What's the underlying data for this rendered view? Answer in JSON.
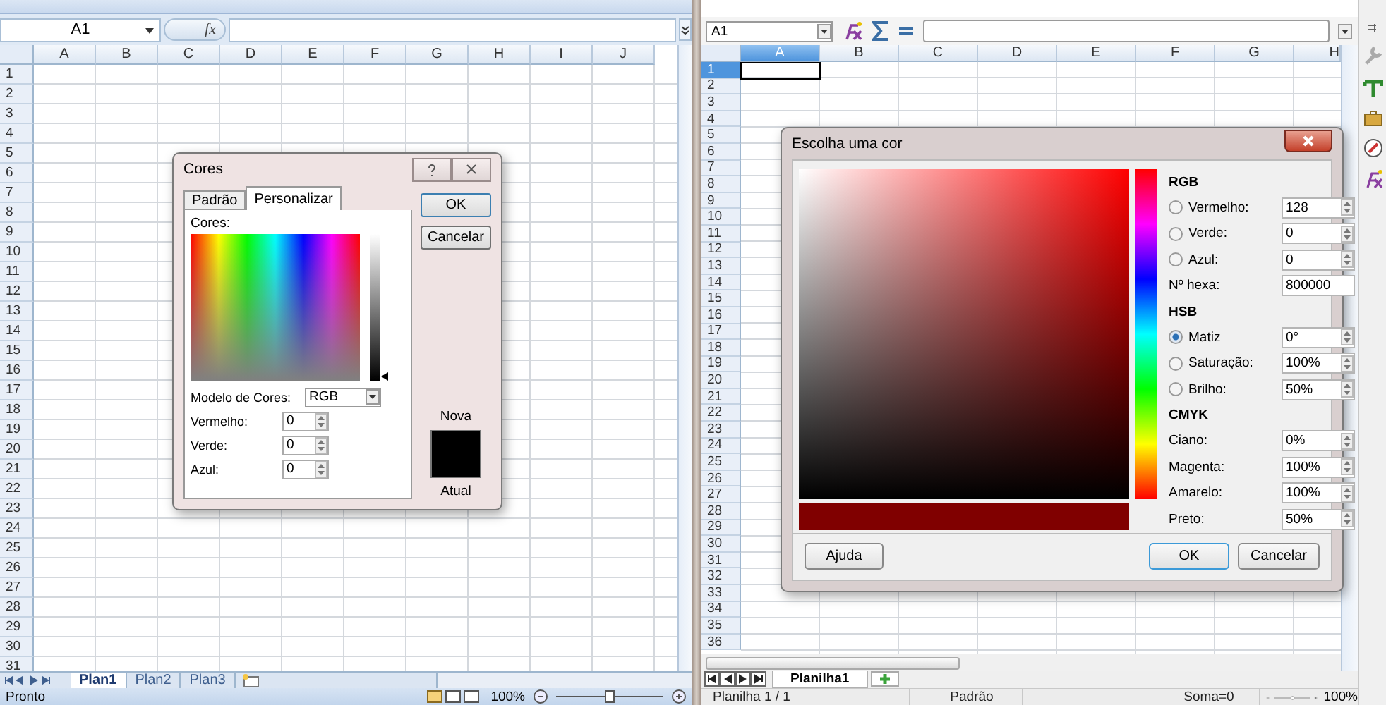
{
  "excel": {
    "name_box": "A1",
    "fx": "fx",
    "columns": [
      "A",
      "B",
      "C",
      "D",
      "E",
      "F",
      "G",
      "H",
      "I",
      "J"
    ],
    "rows": [
      "1",
      "2",
      "3",
      "4",
      "5",
      "6",
      "7",
      "8",
      "9",
      "10",
      "11",
      "12",
      "13",
      "14",
      "15",
      "16",
      "17",
      "18",
      "19",
      "20",
      "21",
      "22",
      "23",
      "24",
      "25",
      "26",
      "27",
      "28",
      "29",
      "30",
      "31"
    ],
    "sheet_tabs": [
      {
        "label": "Plan1",
        "selected": true
      },
      {
        "label": "Plan2",
        "selected": false
      },
      {
        "label": "Plan3",
        "selected": false
      }
    ],
    "status": "Pronto",
    "zoom": "100%",
    "zoom_slider": {
      "level": 0.5
    }
  },
  "cores_dialog": {
    "title": "Cores",
    "tabs": [
      {
        "label": "Padrão",
        "selected": false
      },
      {
        "label": "Personalizar",
        "selected": true
      }
    ],
    "colors_label": "Cores:",
    "model_label": "Modelo de Cores:",
    "model_value": "RGB",
    "fields": [
      {
        "label": "Vermelho:",
        "value": "0"
      },
      {
        "label": "Verde:",
        "value": "0"
      },
      {
        "label": "Azul:",
        "value": "0"
      }
    ],
    "new_label": "Nova",
    "current_label": "Atual",
    "buttons": [
      "OK",
      "Cancelar"
    ]
  },
  "calc": {
    "name_box": "A1",
    "columns": [
      {
        "label": "A",
        "selected": true
      },
      {
        "label": "B",
        "selected": false
      },
      {
        "label": "C",
        "selected": false
      },
      {
        "label": "D",
        "selected": false
      },
      {
        "label": "E",
        "selected": false
      },
      {
        "label": "F",
        "selected": false
      },
      {
        "label": "G",
        "selected": false
      },
      {
        "label": "H",
        "selected": false
      }
    ],
    "rows": [
      {
        "label": "1",
        "selected": true
      },
      {
        "label": "2",
        "selected": false
      },
      {
        "label": "3",
        "selected": false
      },
      {
        "label": "4",
        "selected": false
      },
      {
        "label": "5",
        "selected": false
      },
      {
        "label": "6",
        "selected": false
      },
      {
        "label": "7",
        "selected": false
      },
      {
        "label": "8",
        "selected": false
      },
      {
        "label": "9",
        "selected": false
      },
      {
        "label": "10",
        "selected": false
      },
      {
        "label": "11",
        "selected": false
      },
      {
        "label": "12",
        "selected": false
      },
      {
        "label": "13",
        "selected": false
      },
      {
        "label": "14",
        "selected": false
      },
      {
        "label": "15",
        "selected": false
      },
      {
        "label": "16",
        "selected": false
      },
      {
        "label": "17",
        "selected": false
      },
      {
        "label": "18",
        "selected": false
      },
      {
        "label": "19",
        "selected": false
      },
      {
        "label": "20",
        "selected": false
      },
      {
        "label": "21",
        "selected": false
      },
      {
        "label": "22",
        "selected": false
      },
      {
        "label": "23",
        "selected": false
      },
      {
        "label": "24",
        "selected": false
      },
      {
        "label": "25",
        "selected": false
      },
      {
        "label": "26",
        "selected": false
      },
      {
        "label": "27",
        "selected": false
      },
      {
        "label": "28",
        "selected": false
      },
      {
        "label": "29",
        "selected": false
      },
      {
        "label": "30",
        "selected": false
      },
      {
        "label": "31",
        "selected": false
      },
      {
        "label": "32",
        "selected": false
      },
      {
        "label": "33",
        "selected": false
      },
      {
        "label": "34",
        "selected": false
      },
      {
        "label": "35",
        "selected": false
      },
      {
        "label": "36",
        "selected": false
      }
    ],
    "sheet_tabs": [
      {
        "label": "Planilha1",
        "selected": true
      }
    ],
    "status": [
      "Planilha 1 / 1",
      "Padrão",
      "Soma=0"
    ],
    "zoom": "100%",
    "zoom_slider": {
      "level": 0.5
    }
  },
  "color_dialog": {
    "title": "Escolha uma cor",
    "sections": [
      {
        "title": "RGB",
        "rows": [
          {
            "kind": "radio",
            "label": "Vermelho:",
            "value": "128",
            "selected": false
          },
          {
            "kind": "radio",
            "label": "Verde:",
            "value": "0",
            "selected": false
          },
          {
            "kind": "radio",
            "label": "Azul:",
            "value": "0",
            "selected": false
          },
          {
            "kind": "text",
            "label": "Nº hexa:",
            "value": "800000"
          }
        ]
      },
      {
        "title": "HSB",
        "rows": [
          {
            "kind": "radio",
            "label": "Matiz",
            "value": "0°",
            "selected": true
          },
          {
            "kind": "radio",
            "label": "Saturação:",
            "value": "100%",
            "selected": false
          },
          {
            "kind": "radio",
            "label": "Brilho:",
            "value": "50%",
            "selected": false
          }
        ]
      },
      {
        "title": "CMYK",
        "rows": [
          {
            "kind": "spin",
            "label": "Ciano:",
            "value": "0%"
          },
          {
            "kind": "spin",
            "label": "Magenta:",
            "value": "100%"
          },
          {
            "kind": "spin",
            "label": "Amarelo:",
            "value": "100%"
          },
          {
            "kind": "spin",
            "label": "Preto:",
            "value": "50%"
          }
        ]
      }
    ],
    "buttons": [
      {
        "label": "Ajuda",
        "kind": "help"
      },
      {
        "label": "OK",
        "kind": "default"
      },
      {
        "label": "Cancelar",
        "kind": "normal"
      }
    ]
  }
}
